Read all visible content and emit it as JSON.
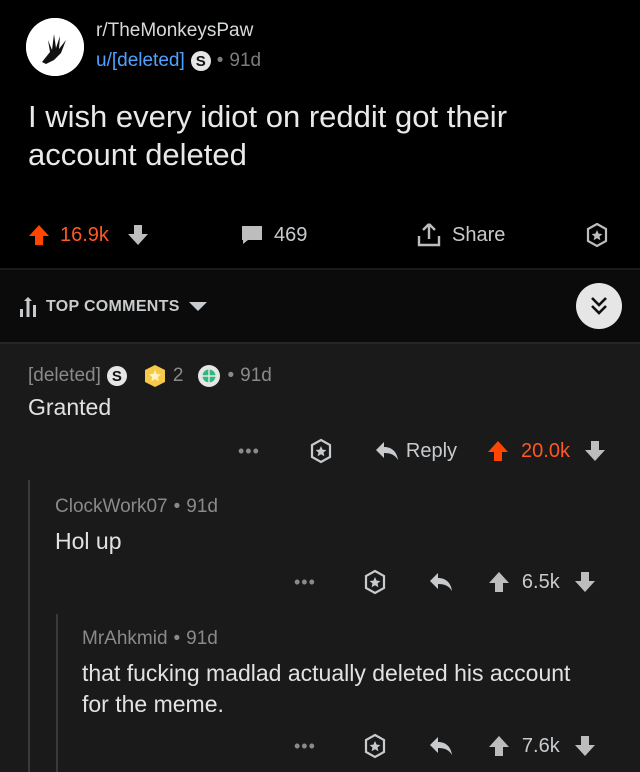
{
  "post": {
    "subreddit": "r/TheMonkeysPaw",
    "author": "u/[deleted]",
    "age": "91d",
    "title": "I wish every idiot on reddit got their account deleted",
    "score": "16.9k",
    "comments": "469",
    "share_label": "Share"
  },
  "sort": {
    "label": "TOP COMMENTS"
  },
  "comments": [
    {
      "author": "[deleted]",
      "award_count": "2",
      "age": "91d",
      "body": "Granted",
      "reply_label": "Reply",
      "score": "20.0k"
    },
    {
      "author": "ClockWork07",
      "age": "91d",
      "body": "Hol up",
      "score": "6.5k"
    },
    {
      "author": "MrAhkmid",
      "age": "91d",
      "body": "that fucking madlad actually deleted his account for the meme.",
      "score": "7.6k"
    }
  ],
  "colors": {
    "upvote": "#ff4500",
    "link": "#4fa3ff",
    "background": "#1a1a1b"
  }
}
